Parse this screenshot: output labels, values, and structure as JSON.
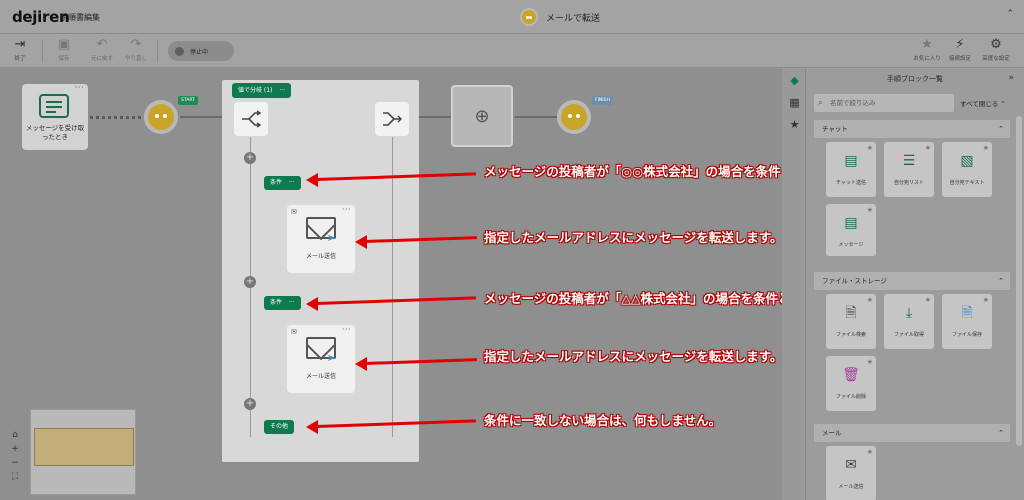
{
  "header": {
    "logo": "dejiren",
    "doc_title": "手順書編集",
    "center_title": "メールで転送",
    "collapse_glyph": "⌃"
  },
  "toolbar": {
    "exit_label": "終了",
    "save_label": "保存",
    "undo_label": "元に戻す",
    "redo_label": "やり直し",
    "status_label": "停止中",
    "favorite_label": "お気に入り",
    "connect_label": "接続設定",
    "advanced_label": "高度な設定"
  },
  "canvas": {
    "trigger_label": "メッセージを受け取ったとき",
    "start_tag": "START",
    "finish_tag": "FINISH",
    "branch_title": "値で分岐 (1)",
    "more_glyph": "···",
    "conditions": [
      "条件",
      "条件",
      "その他"
    ],
    "mail_blocks": [
      "メール送信",
      "メール送信"
    ]
  },
  "annotations": [
    "メッセージの投稿者が「◎◎株式会社」の場合を条件とします。",
    "指定したメールアドレスにメッセージを転送します。",
    "メッセージの投稿者が「△△株式会社」の場合を条件とします。",
    "指定したメールアドレスにメッセージを転送します。",
    "条件に一致しない場合は、何もしません。"
  ],
  "panel": {
    "title": "手順ブロック一覧",
    "close_glyph": "»",
    "search_placeholder": "名前で絞り込み",
    "close_all": "すべて閉じる",
    "sections": [
      {
        "label": "チャット",
        "blocks": [
          "チャット送信",
          "自分宛リスト",
          "自分宛テキスト",
          "メッセージ"
        ]
      },
      {
        "label": "ファイル・ストレージ",
        "blocks": [
          "ファイル検索",
          "ファイル取得",
          "ファイル保存",
          "ファイル削除"
        ]
      },
      {
        "label": "メール",
        "blocks": [
          "メール送信"
        ]
      }
    ]
  },
  "colors": {
    "accent": "#0f7a4f",
    "annotation": "#e00000",
    "face": "#c9a429"
  }
}
